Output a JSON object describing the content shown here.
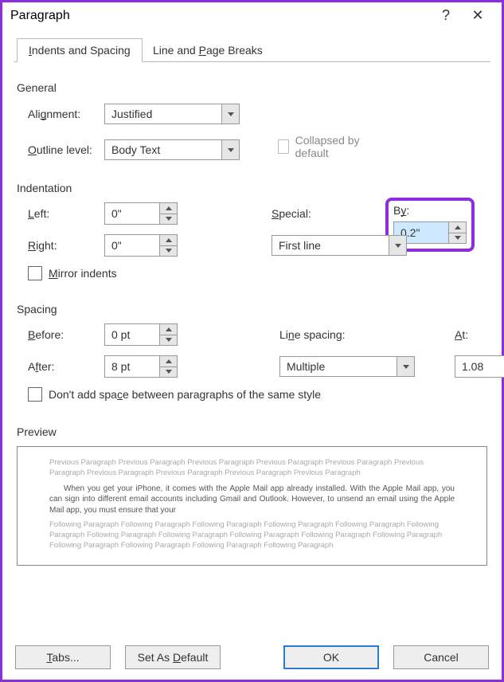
{
  "titlebar": {
    "title": "Paragraph",
    "help": "?",
    "close": "✕"
  },
  "tabs": [
    {
      "label_ul": "I",
      "label_rest": "ndents and Spacing"
    },
    {
      "label_pre": "Line and ",
      "label_ul": "P",
      "label_rest": "age Breaks"
    }
  ],
  "general": {
    "section": "General",
    "alignment": {
      "label_pre": "Ali",
      "label_ul": "g",
      "label_rest": "nment:",
      "value": "Justified"
    },
    "outline": {
      "label_ul": "O",
      "label_rest": "utline level:",
      "value": "Body Text"
    },
    "collapsed_label": "Collapsed by default"
  },
  "indent": {
    "section": "Indentation",
    "left": {
      "label_ul": "L",
      "label_rest": "eft:",
      "value": "0\""
    },
    "right": {
      "label_ul": "R",
      "label_rest": "ight:",
      "value": "0\""
    },
    "special": {
      "label_ul": "S",
      "label_rest": "pecial:",
      "value": "First line"
    },
    "by": {
      "label_pre": "B",
      "label_ul": "y",
      "label_rest": ":",
      "value": "0.2\""
    },
    "mirror": {
      "label_ul": "M",
      "label_rest": "irror indents"
    }
  },
  "spacing": {
    "section": "Spacing",
    "before": {
      "label_ul": "B",
      "label_rest": "efore:",
      "value": "0 pt"
    },
    "after": {
      "label_pre": "A",
      "label_ul": "f",
      "label_rest": "ter:",
      "value": "8 pt"
    },
    "line": {
      "label_pre": "Li",
      "label_ul": "n",
      "label_rest": "e spacing:",
      "value": "Multiple"
    },
    "at": {
      "label_ul": "A",
      "label_rest": "t:",
      "value": "1.08"
    },
    "nospace": {
      "label_pre": "Don't add spa",
      "label_ul": "c",
      "label_rest": "e between paragraphs of the same style"
    }
  },
  "preview": {
    "section": "Preview",
    "prev": "Previous Paragraph Previous Paragraph Previous Paragraph Previous Paragraph Previous Paragraph Previous Paragraph Previous Paragraph Previous Paragraph Previous Paragraph Previous Paragraph",
    "main": "When you get your iPhone, it comes with the Apple Mail app already installed. With the Apple Mail app, you can sign into different email accounts including Gmail and Outlook. However, to unsend an email using the Apple Mail app, you must ensure that your",
    "next": "Following Paragraph Following Paragraph Following Paragraph Following Paragraph Following Paragraph Following Paragraph Following Paragraph Following Paragraph Following Paragraph Following Paragraph Following Paragraph Following Paragraph Following Paragraph Following Paragraph Following Paragraph"
  },
  "buttons": {
    "tabs": {
      "label_ul": "T",
      "label_rest": "abs..."
    },
    "setdefault": {
      "label_pre": "Set As ",
      "label_ul": "D",
      "label_rest": "efault"
    },
    "ok": "OK",
    "cancel": "Cancel"
  }
}
